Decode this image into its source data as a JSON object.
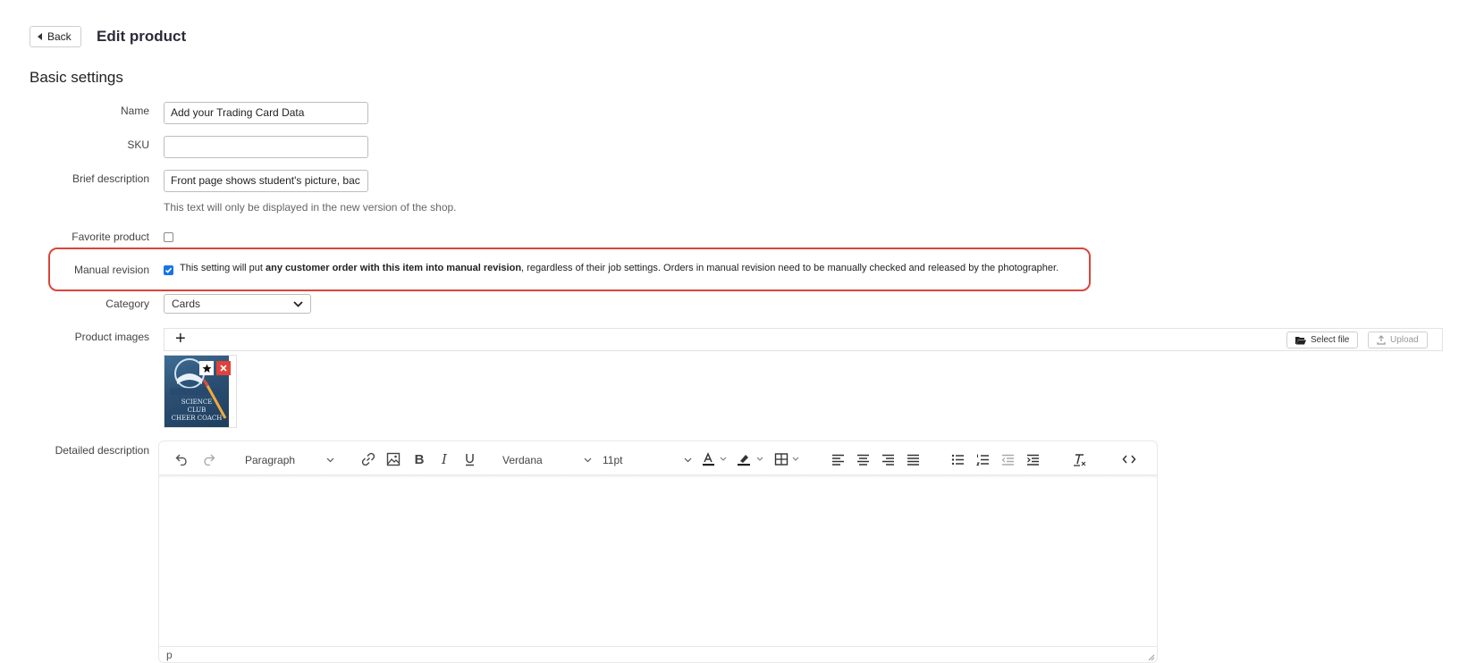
{
  "header": {
    "back_label": "Back",
    "title": "Edit product"
  },
  "section": {
    "title": "Basic settings"
  },
  "form": {
    "name_label": "Name",
    "name_value": "Add your Trading Card Data",
    "sku_label": "SKU",
    "sku_value": "",
    "brief_label": "Brief description",
    "brief_value": "Front page shows student's picture, bac",
    "brief_help": "This text will only be displayed in the new version of the shop.",
    "favorite_label": "Favorite product",
    "favorite_checked": false,
    "manual_revision_label": "Manual revision",
    "manual_revision_checked": true,
    "manual_revision_text_prefix": "This setting will put ",
    "manual_revision_text_bold": "any customer order with this item into manual revision",
    "manual_revision_text_suffix": ", regardless of their job settings. Orders in manual revision need to be manually checked and released by the photographer.",
    "category_label": "Category",
    "category_value": "Cards",
    "product_images_label": "Product images",
    "add_image_symbol": "+",
    "select_file_label": "Select file",
    "upload_label": "Upload",
    "thumbnail_text": [
      "SCIENCE",
      "CLUB",
      "CHEER COACH"
    ],
    "detailed_description_label": "Detailed description"
  },
  "editor": {
    "block_format": "Paragraph",
    "font_family": "Verdana",
    "font_size": "11pt",
    "status_path": "p",
    "icons": [
      "undo-icon",
      "redo-icon",
      "link-icon",
      "image-icon",
      "bold-icon",
      "italic-icon",
      "underline-icon",
      "text-color-icon",
      "highlight-icon",
      "table-icon",
      "align-left-icon",
      "align-center-icon",
      "align-right-icon",
      "align-justify-icon",
      "bullet-list-icon",
      "numbered-list-icon",
      "outdent-icon",
      "indent-icon",
      "clear-format-icon",
      "source-code-icon"
    ]
  },
  "colors": {
    "highlight_border": "#d9463a",
    "checkbox_accent": "#1a73e8",
    "delete_badge": "#e0413a"
  }
}
